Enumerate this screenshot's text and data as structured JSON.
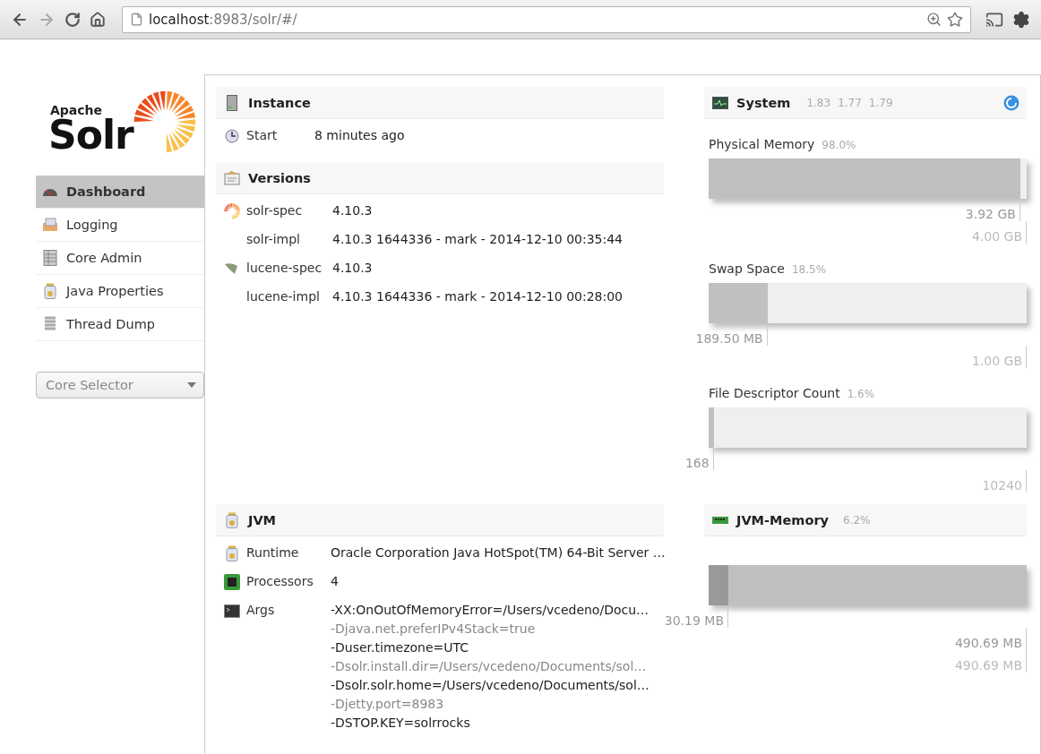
{
  "browser": {
    "url_host": "localhost",
    "url_path": ":8983/solr/#/"
  },
  "logo": {
    "top": "Apache",
    "main": "Solr"
  },
  "nav": [
    {
      "label": "Dashboard",
      "selected": true
    },
    {
      "label": "Logging",
      "selected": false
    },
    {
      "label": "Core Admin",
      "selected": false
    },
    {
      "label": "Java Properties",
      "selected": false
    },
    {
      "label": "Thread Dump",
      "selected": false
    }
  ],
  "core_selector": {
    "placeholder": "Core Selector"
  },
  "instance": {
    "title": "Instance",
    "rows": [
      {
        "label": "Start",
        "value": "8 minutes ago"
      }
    ]
  },
  "versions": {
    "title": "Versions",
    "rows": [
      {
        "kind": "solr",
        "label": "solr-spec",
        "value": "4.10.3"
      },
      {
        "kind": "plain",
        "label": "solr-impl",
        "value": "4.10.3 1644336 - mark - 2014-12-10 00:35:44"
      },
      {
        "kind": "lucene",
        "label": "lucene-spec",
        "value": "4.10.3"
      },
      {
        "kind": "plain",
        "label": "lucene-impl",
        "value": "4.10.3 1644336 - mark - 2014-12-10 00:28:00"
      }
    ]
  },
  "system": {
    "title": "System",
    "loads": [
      "1.83",
      "1.77",
      "1.79"
    ],
    "meters": [
      {
        "title": "Physical Memory",
        "percent": "98.0%",
        "level": 0.98,
        "used": "3.92 GB",
        "total": "4.00 GB"
      },
      {
        "title": "Swap Space",
        "percent": "18.5%",
        "level": 0.185,
        "used": "189.50 MB",
        "total": "1.00 GB"
      },
      {
        "title": "File Descriptor Count",
        "percent": "1.6%",
        "level": 0.016,
        "used": "168",
        "total": "10240"
      }
    ]
  },
  "jvm": {
    "title": "JVM",
    "rows": [
      {
        "kind": "runtime",
        "label": "Runtime",
        "values": [
          "Oracle Corporation Java HotSpot(TM) 64-Bit Server …"
        ]
      },
      {
        "kind": "processors",
        "label": "Processors",
        "values": [
          "4"
        ]
      },
      {
        "kind": "args",
        "label": "Args",
        "values": [
          "-XX:OnOutOfMemoryError=/Users/vcedeno/Docu…",
          "-Djava.net.preferIPv4Stack=true",
          "-Duser.timezone=UTC",
          "-Dsolr.install.dir=/Users/vcedeno/Documents/sol…",
          "-Dsolr.solr.home=/Users/vcedeno/Documents/sol…",
          "-Djetty.port=8983",
          "-DSTOP.KEY=solrrocks"
        ]
      }
    ]
  },
  "jvm_memory": {
    "title": "JVM-Memory",
    "percent": "6.2%",
    "used": {
      "level": 0.062,
      "reading": "30.19 MB"
    },
    "committed": {
      "reading": "490.69 MB"
    },
    "max": "490.69 MB"
  }
}
